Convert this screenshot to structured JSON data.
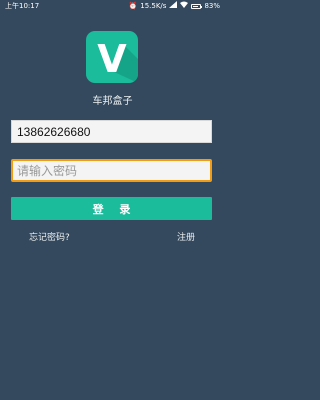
{
  "status_bar": {
    "time": "上午10:17",
    "network_speed": "15.5K/s",
    "battery_percent": "83%",
    "battery_level": 0.83,
    "icons": [
      "alarm-icon",
      "signal-icon",
      "wifi-icon",
      "battery-icon"
    ]
  },
  "app": {
    "logo_letter": "V",
    "name": "车邦盒子",
    "brand_color": "#1abc9c"
  },
  "login_form": {
    "phone_value": "13862626680",
    "password_placeholder": "请输入密码",
    "password_value": "",
    "login_label": "登 录",
    "forgot_password_label": "忘记密码?",
    "register_label": "注册"
  },
  "colors": {
    "background": "#34495e",
    "accent": "#1abc9c",
    "focus_border": "#f39c12"
  }
}
